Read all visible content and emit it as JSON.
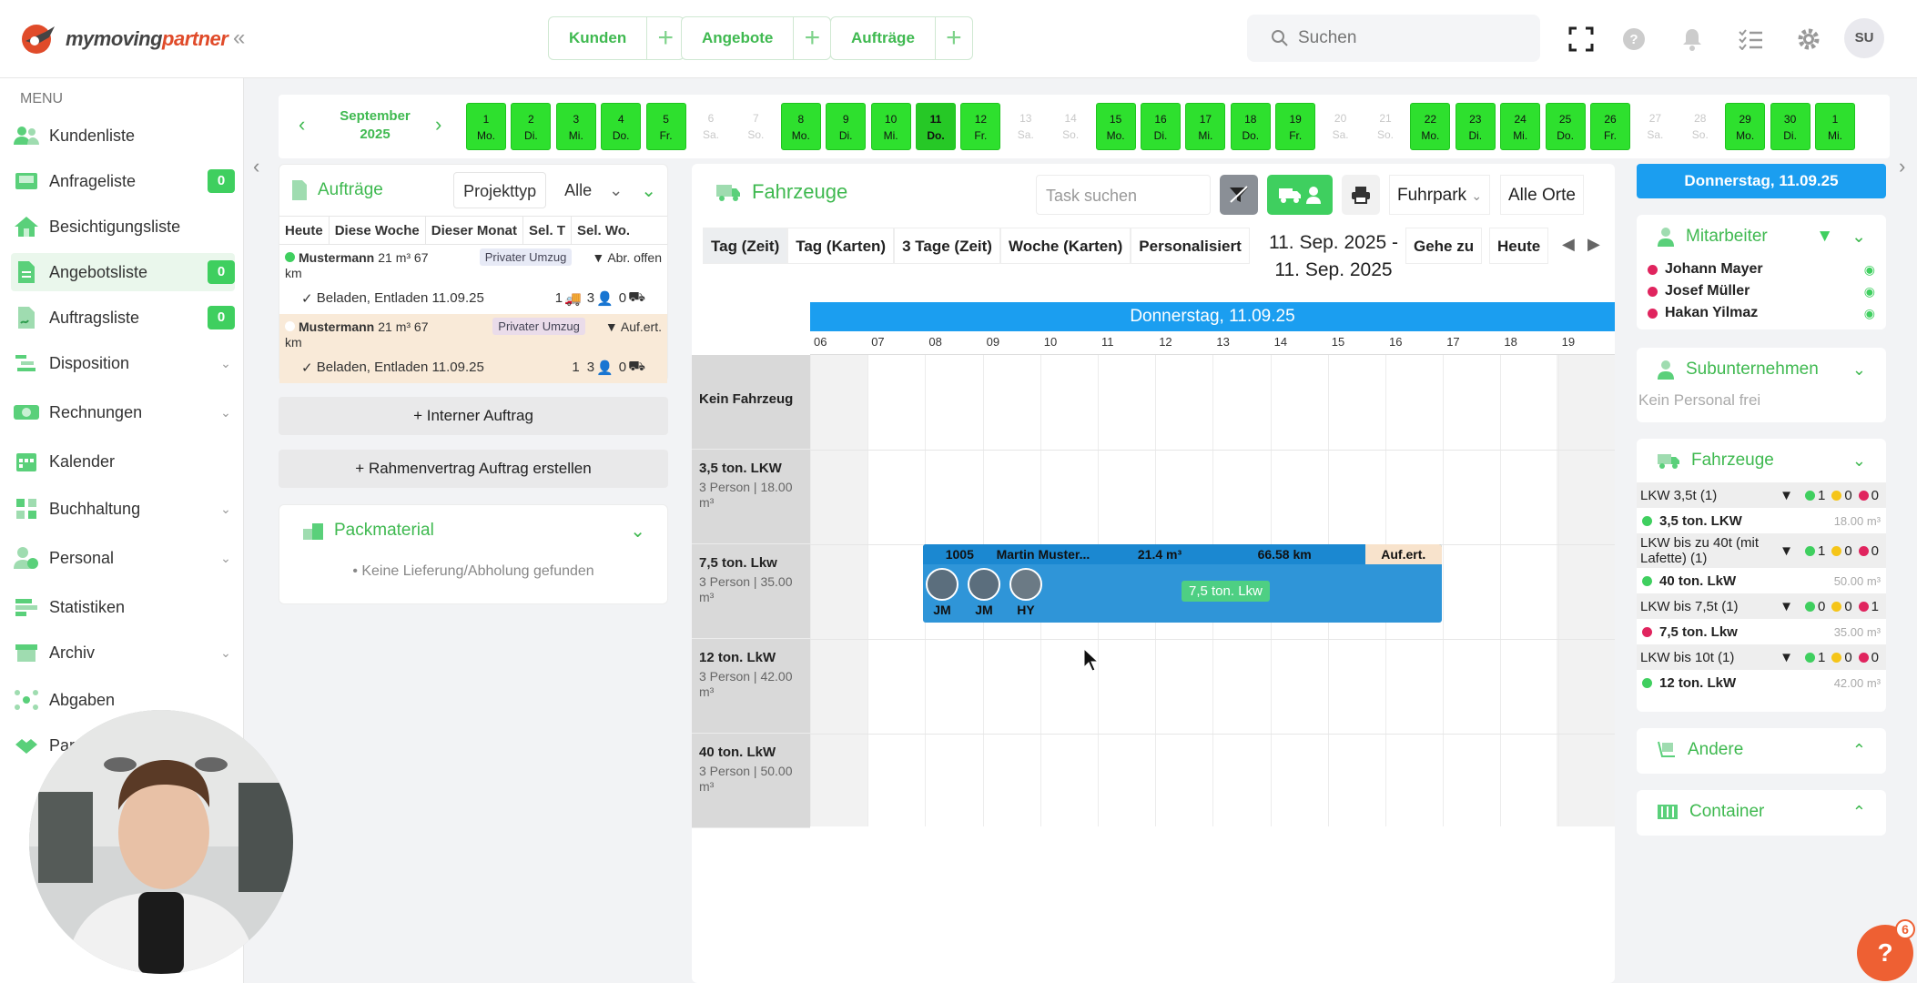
{
  "app": {
    "brand_main": "mymoving",
    "brand_accent": "partner"
  },
  "topbar": {
    "groups": [
      {
        "label": "Kunden"
      },
      {
        "label": "Angebote"
      },
      {
        "label": "Aufträge"
      }
    ],
    "search_placeholder": "Suchen",
    "avatar_initials": "SU"
  },
  "sidebar": {
    "menu_title": "MENU",
    "items": [
      {
        "label": "Kundenliste",
        "badge": null
      },
      {
        "label": "Anfrageliste",
        "badge": "0"
      },
      {
        "label": "Besichtigungsliste",
        "badge": null
      },
      {
        "label": "Angebotsliste",
        "badge": "0"
      },
      {
        "label": "Auftragsliste",
        "badge": "0"
      },
      {
        "label": "Disposition",
        "badge": null
      },
      {
        "label": "Rechnungen",
        "badge": null
      },
      {
        "label": "Kalender",
        "badge": null
      },
      {
        "label": "Buchhaltung",
        "badge": null
      },
      {
        "label": "Personal",
        "badge": null
      },
      {
        "label": "Statistiken",
        "badge": null
      },
      {
        "label": "Archiv",
        "badge": null
      },
      {
        "label": "Abgaben",
        "badge": null
      },
      {
        "label": "Par",
        "badge": null
      }
    ]
  },
  "datestrip": {
    "month": "September",
    "year": "2025",
    "days": [
      {
        "n": "1",
        "d": "Mo.",
        "t": "work"
      },
      {
        "n": "2",
        "d": "Di.",
        "t": "work"
      },
      {
        "n": "3",
        "d": "Mi.",
        "t": "work"
      },
      {
        "n": "4",
        "d": "Do.",
        "t": "work"
      },
      {
        "n": "5",
        "d": "Fr.",
        "t": "work"
      },
      {
        "n": "6",
        "d": "Sa.",
        "t": "off"
      },
      {
        "n": "7",
        "d": "So.",
        "t": "off"
      },
      {
        "n": "8",
        "d": "Mo.",
        "t": "work"
      },
      {
        "n": "9",
        "d": "Di.",
        "t": "work"
      },
      {
        "n": "10",
        "d": "Mi.",
        "t": "work"
      },
      {
        "n": "11",
        "d": "Do.",
        "t": "today"
      },
      {
        "n": "12",
        "d": "Fr.",
        "t": "work"
      },
      {
        "n": "13",
        "d": "Sa.",
        "t": "off"
      },
      {
        "n": "14",
        "d": "So.",
        "t": "off"
      },
      {
        "n": "15",
        "d": "Mo.",
        "t": "work"
      },
      {
        "n": "16",
        "d": "Di.",
        "t": "work"
      },
      {
        "n": "17",
        "d": "Mi.",
        "t": "work"
      },
      {
        "n": "18",
        "d": "Do.",
        "t": "work"
      },
      {
        "n": "19",
        "d": "Fr.",
        "t": "work"
      },
      {
        "n": "20",
        "d": "Sa.",
        "t": "off"
      },
      {
        "n": "21",
        "d": "So.",
        "t": "off"
      },
      {
        "n": "22",
        "d": "Mo.",
        "t": "work"
      },
      {
        "n": "23",
        "d": "Di.",
        "t": "work"
      },
      {
        "n": "24",
        "d": "Mi.",
        "t": "work"
      },
      {
        "n": "25",
        "d": "Do.",
        "t": "work"
      },
      {
        "n": "26",
        "d": "Fr.",
        "t": "work"
      },
      {
        "n": "27",
        "d": "Sa.",
        "t": "off"
      },
      {
        "n": "28",
        "d": "So.",
        "t": "off"
      },
      {
        "n": "29",
        "d": "Mo.",
        "t": "work"
      },
      {
        "n": "30",
        "d": "Di.",
        "t": "work"
      },
      {
        "n": "1",
        "d": "Mi.",
        "t": "work"
      }
    ]
  },
  "auftraege": {
    "title": "Aufträge",
    "projekttyp": "Projekttyp",
    "filter": "Alle",
    "tabs": [
      "Heute",
      "Diese Woche",
      "Dieser Monat",
      "Sel. T",
      "Sel. Wo."
    ],
    "orders": [
      {
        "name": "Mustermann",
        "meta": "21 m³  67",
        "unit": "km",
        "type": "Privater Umzug",
        "status": "Abr. offen",
        "task": "Beladen, Entladen 11.09.25",
        "c1": "1",
        "c2": "3",
        "c3": "0"
      },
      {
        "name": "Mustermann",
        "meta": "21 m³  67",
        "unit": "km",
        "type": "Privater Umzug",
        "status": "Auf.ert.",
        "task": "Beladen, Entladen 11.09.25",
        "c1": "1",
        "c2": "3",
        "c3": "0"
      }
    ],
    "btn_internal": "+ Interner Auftrag",
    "btn_rahmen": "+ Rahmenvertrag Auftrag erstellen"
  },
  "packmaterial": {
    "title": "Packmaterial",
    "empty": "• Keine Lieferung/Abholung gefunden"
  },
  "center": {
    "title": "Fahrzeuge",
    "task_placeholder": "Task suchen",
    "fuhrpark": "Fuhrpark",
    "alle_orte": "Alle Orte",
    "views": [
      "Tag (Zeit)",
      "Tag (Karten)",
      "3 Tage (Zeit)",
      "Woche (Karten)",
      "Personalisiert"
    ],
    "range_line1": "11. Sep. 2025 -",
    "range_line2": "11. Sep. 2025",
    "goto": "Gehe zu",
    "today": "Heute",
    "day_header": "Donnerstag, 11.09.25",
    "hours": [
      "06",
      "07",
      "08",
      "09",
      "10",
      "11",
      "12",
      "13",
      "14",
      "15",
      "16",
      "17",
      "18",
      "19"
    ],
    "rows": [
      {
        "title": "Kein Fahrzeug",
        "sub": ""
      },
      {
        "title": "3,5 ton. LKW",
        "sub": "3 Person | 18.00 m³"
      },
      {
        "title": "7,5 ton. Lkw",
        "sub": "3 Person | 35.00 m³"
      },
      {
        "title": "12 ton. LkW",
        "sub": "3 Person | 42.00 m³"
      },
      {
        "title": "40 ton. LkW",
        "sub": "3 Person | 50.00 m³"
      }
    ],
    "job": {
      "id": "1005",
      "customer": "Martin Muster...",
      "volume": "21.4 m³",
      "distance": "66.58 km",
      "status": "Auf.ert.",
      "staff": [
        "JM",
        "JM",
        "HY"
      ],
      "vehicle": "7,5 ton. Lkw"
    }
  },
  "right": {
    "date": "Donnerstag, 11.09.25",
    "mitarbeiter_title": "Mitarbeiter",
    "employees": [
      "Johann Mayer",
      "Josef Müller",
      "Hakan Yilmaz"
    ],
    "sub_title": "Subunternehmen",
    "sub_empty": "Kein Personal frei",
    "fahrzeuge_title": "Fahrzeuge",
    "vehicles": [
      {
        "group": "LKW 3,5t (1)",
        "counts": [
          "1",
          "0",
          "0"
        ],
        "name": "3,5 ton. LKW",
        "vol": "18.00 m³",
        "dot": "#3fcf5f"
      },
      {
        "group": "LKW bis zu 40t (mit Lafette) (1)",
        "counts": [
          "1",
          "0",
          "0"
        ],
        "name": "40 ton. LkW",
        "vol": "50.00 m³",
        "dot": "#3fcf5f"
      },
      {
        "group": "LKW bis 7,5t (1)",
        "counts": [
          "0",
          "0",
          "1"
        ],
        "name": "7,5 ton. Lkw",
        "vol": "35.00 m³",
        "dot": "#e0245e"
      },
      {
        "group": "LKW bis 10t (1)",
        "counts": [
          "1",
          "0",
          "0"
        ],
        "name": "12 ton. LkW",
        "vol": "42.00 m³",
        "dot": "#3fcf5f"
      }
    ],
    "andere_title": "Andere",
    "container_title": "Container"
  },
  "help": {
    "label": "?",
    "badge": "6"
  },
  "colors": {
    "accent_green": "#3fb950",
    "blue": "#1b9ef0",
    "day_green": "#2ee02e",
    "red": "#e0245e",
    "yellow": "#f5c518"
  }
}
